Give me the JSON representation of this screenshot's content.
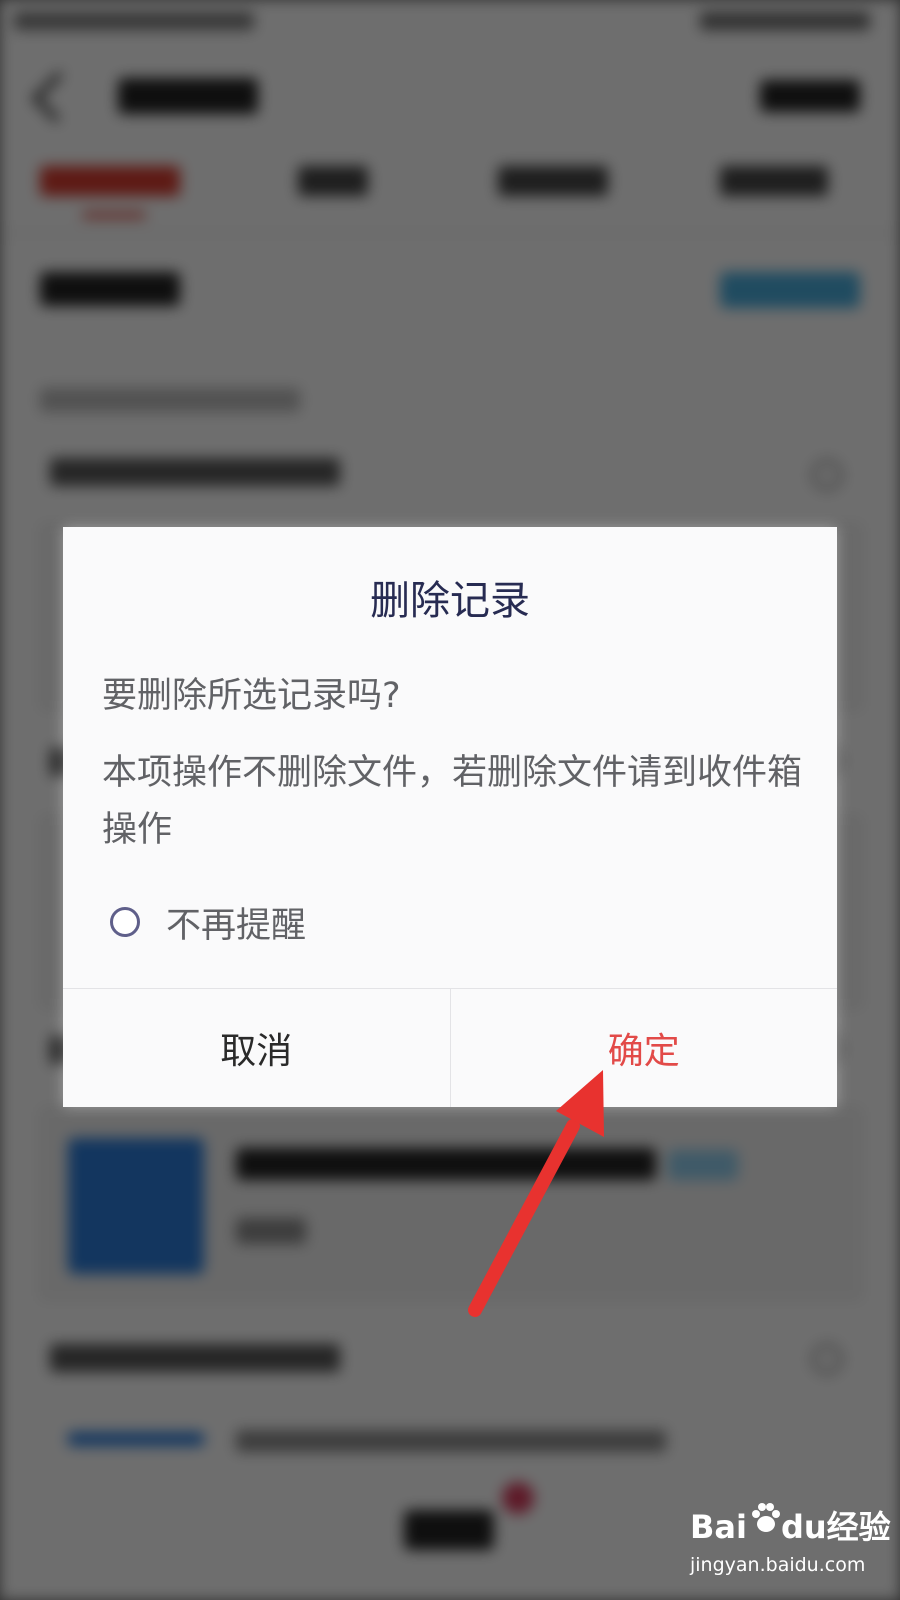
{
  "dialog": {
    "title": "删除记录",
    "question": "要删除所选记录吗?",
    "note": "本项操作不删除文件，若删除文件请到收件箱操作",
    "remind_label": "不再提醒",
    "remind_checked": false,
    "cancel_label": "取消",
    "confirm_label": "确定"
  },
  "colors": {
    "confirm": "#e24a48",
    "title": "#272b52",
    "arrow": "#e8322f"
  },
  "watermark": {
    "brand": "Baidu经验",
    "url": "jingyan.baidu.com"
  }
}
